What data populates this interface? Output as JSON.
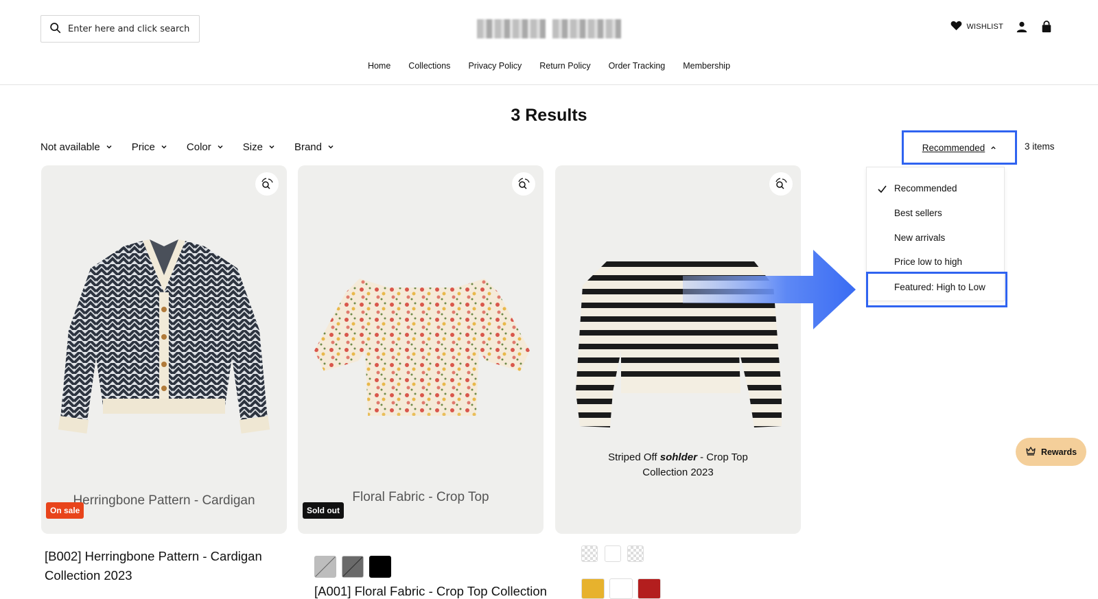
{
  "header": {
    "search_placeholder": "Enter here and click search",
    "wishlist_label": "WISHLIST",
    "nav": [
      "Home",
      "Collections",
      "Privacy Policy",
      "Return Policy",
      "Order Tracking",
      "Membership"
    ]
  },
  "results": {
    "title": "3 Results",
    "filters": [
      "Not available",
      "Price",
      "Color",
      "Size",
      "Brand"
    ],
    "sort_label": "Recommended",
    "items_count": "3 items",
    "sort_options": [
      "Recommended",
      "Best sellers",
      "New arrivals",
      "Price low to high",
      "Featured: High to Low"
    ],
    "selected_option": "Recommended"
  },
  "products": [
    {
      "image_caption": "Herringbone Pattern - Cardigan",
      "badge": "On sale",
      "title_line1": "[B002] Herringbone Pattern - Cardigan",
      "title_line2": "Collection 2023"
    },
    {
      "image_caption": "Floral Fabric - Crop Top",
      "badge": "Sold out",
      "title_line1": "[A001] Floral Fabric - Crop Top Collection"
    },
    {
      "image_caption_line1_a": "Striped Off ",
      "image_caption_line1_b": "sohlder",
      "image_caption_line1_c": " - Crop Top",
      "image_caption_line2": "Collection 2023"
    }
  ],
  "rewards_label": "Rewards",
  "colors": {
    "accent_blue": "#2f63f0",
    "sale_badge": "#e8441b",
    "rewards_bg": "#f4cf9a"
  }
}
